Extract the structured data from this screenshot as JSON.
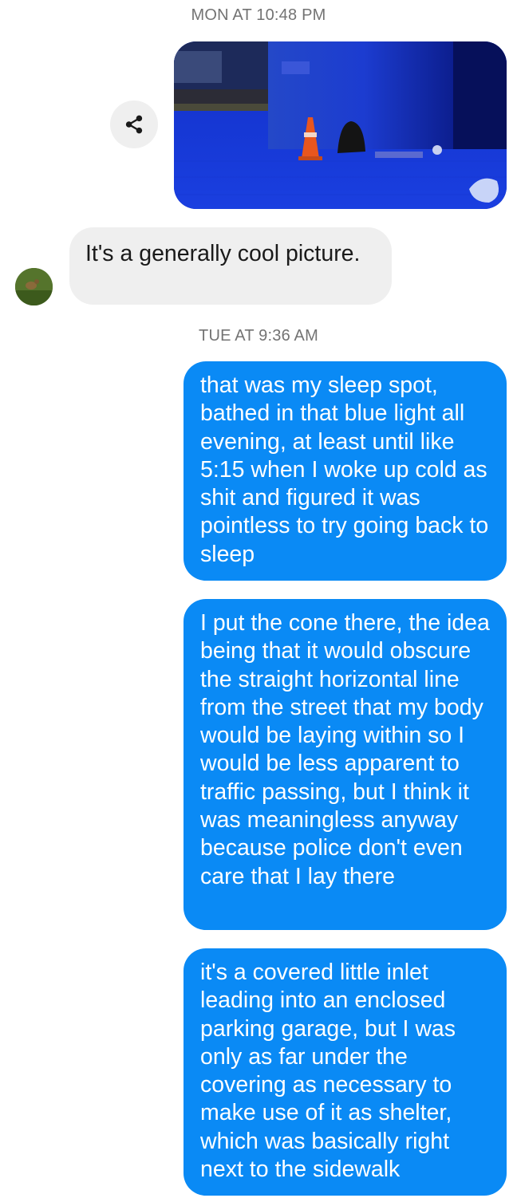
{
  "timestamps": {
    "first": "MON AT 10:48 PM",
    "second": "TUE AT 9:36 AM"
  },
  "photo_message": {
    "icon": "share-icon"
  },
  "received": {
    "avatar_icon": "contact-avatar",
    "text": "It's a generally cool picture."
  },
  "sent": [
    {
      "text": "that was my sleep spot, bathed in that blue light all evening, at least until like 5:15 when I woke up cold as shit and figured it was pointless to try going back to sleep"
    },
    {
      "text": "I put the cone there, the idea being that it would obscure the straight horizontal line from the street that my body would be laying within so I would be less apparent to traffic passing, but I think it was meaningless anyway because police don't even care that I lay there"
    },
    {
      "text": "it's a covered little inlet leading into an enclosed parking garage, but I was only as far under the covering as necessary to make use of it as shelter, which was basically right next to the sidewalk"
    }
  ],
  "colors": {
    "sent_bubble": "#0a8af5",
    "received_bubble": "#efefef",
    "timestamp": "#737373"
  }
}
